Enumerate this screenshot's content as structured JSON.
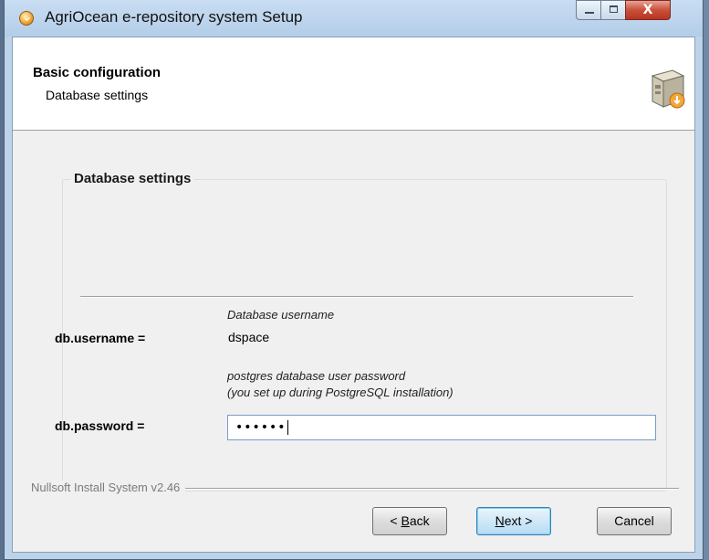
{
  "window": {
    "title": "AgriOcean e-repository system Setup",
    "close_glyph": "X"
  },
  "header": {
    "title": "Basic configuration",
    "subtitle": "Database settings",
    "icon": "installer-box-icon"
  },
  "group": {
    "title": "Database settings"
  },
  "fields": {
    "username": {
      "description": "Database username",
      "label": "db.username =",
      "value": "dspace"
    },
    "password": {
      "description_line1": "postgres database user password",
      "description_line2": "(you set up during PostgreSQL installation)",
      "label": "db.password =",
      "masked_value": "••••••"
    }
  },
  "footer": {
    "branding": "Nullsoft Install System v2.46"
  },
  "buttons": {
    "back": {
      "accel": "B",
      "rest": "ack",
      "prefix": "< "
    },
    "next": {
      "accel": "N",
      "rest": "ext >"
    },
    "cancel": "Cancel"
  },
  "colors": {
    "titlebar": "#bcd3ea",
    "client_bg": "#f0f0f0",
    "close_button": "#c8503c",
    "default_button_border": "#3c7fb1"
  }
}
